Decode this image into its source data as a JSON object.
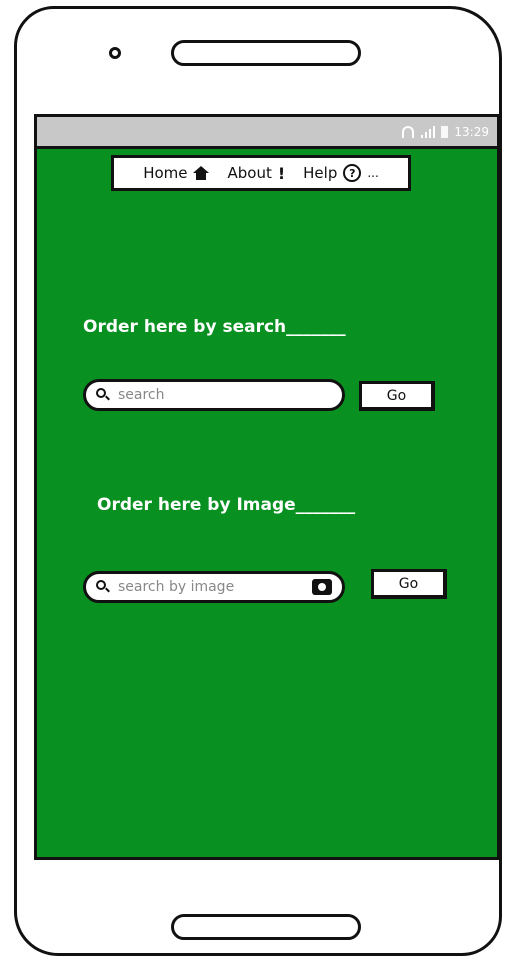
{
  "status_bar": {
    "time": "13:29"
  },
  "nav": {
    "home_label": "Home",
    "about_label": "About",
    "help_label": "Help",
    "help_icon": "?",
    "overflow": "..."
  },
  "search_section": {
    "title": "Order here by search_______",
    "placeholder": "search",
    "go_label": "Go"
  },
  "image_section": {
    "title": "Order here by Image_______",
    "placeholder": "search by image",
    "go_label": "Go"
  },
  "colors": {
    "screen_background": "#089020",
    "status_bar": "#c8c8c8"
  }
}
